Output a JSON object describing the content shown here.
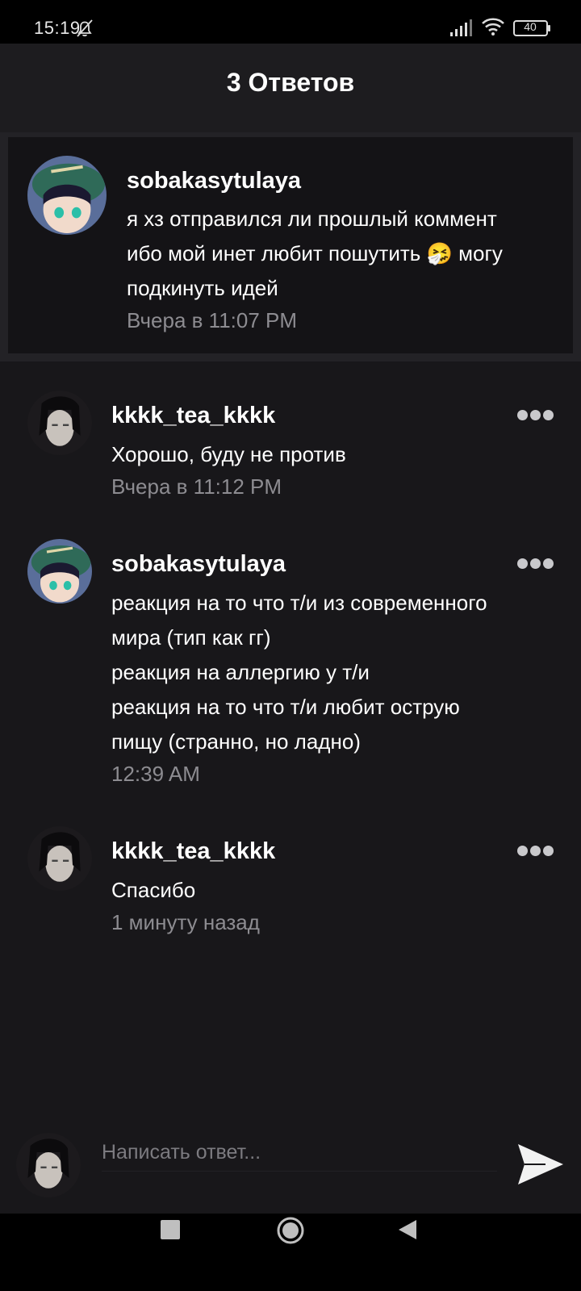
{
  "status_bar": {
    "time": "15:19",
    "battery": "40"
  },
  "header": {
    "title": "3 Ответов"
  },
  "parent_comment": {
    "username": "sobakasytulaya",
    "lines": [
      "я хз отправился ли прошлый коммент",
      "ибо мой инет любит пошутить 🤧 могу",
      "подкинуть идей"
    ],
    "time": "Вчера в 11:07 PM"
  },
  "replies": [
    {
      "username": "kkkk_tea_kkkk",
      "lines": [
        "Хорошо, буду не против"
      ],
      "time": "Вчера в 11:12 PM"
    },
    {
      "username": "sobakasytulaya",
      "lines": [
        "реакция на то что т/и из современного",
        "мира (тип как гг)",
        "реакция на аллергию у т/и",
        "реакция на то что т/и любит острую",
        "пищу (странно, но ладно)"
      ],
      "time": "12:39 AM"
    },
    {
      "username": "kkkk_tea_kkkk",
      "lines": [
        "Спасибо"
      ],
      "time": "1 минуту назад"
    }
  ],
  "reply_input": {
    "placeholder": "Написать ответ..."
  },
  "icons": {
    "mute": "bell-off-icon",
    "signal": "signal-icon",
    "wifi": "wifi-icon",
    "battery": "battery-icon",
    "more": "more-dots-icon",
    "send": "send-icon",
    "nav": [
      "recent-apps-icon",
      "home-icon",
      "back-icon"
    ]
  },
  "colors": {
    "background": "#18171a",
    "header": "#1d1c1f",
    "parent_card": "#141316",
    "muted_text": "#8d8c91",
    "text": "#ffffff"
  }
}
